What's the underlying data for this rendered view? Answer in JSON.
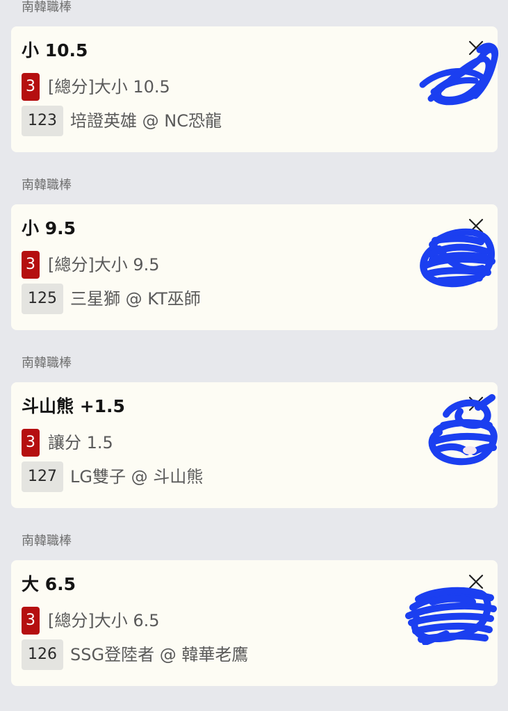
{
  "accent_color": "#b50f10",
  "scribble_color": "#1b3ff0",
  "close_icon": "close-icon",
  "bets": [
    {
      "league": "南韓職棒",
      "title": "小 10.5",
      "count": "3",
      "bet_type": "[總分]大小 10.5",
      "match_id": "123",
      "match": "培證英雄 @ NC恐龍"
    },
    {
      "league": "南韓職棒",
      "title": "小 9.5",
      "count": "3",
      "bet_type": "[總分]大小 9.5",
      "match_id": "125",
      "match": "三星獅 @ KT巫師"
    },
    {
      "league": "南韓職棒",
      "title": "斗山熊 +1.5",
      "count": "3",
      "bet_type": "讓分 1.5",
      "match_id": "127",
      "match": "LG雙子 @ 斗山熊"
    },
    {
      "league": "南韓職棒",
      "title": "大 6.5",
      "count": "3",
      "bet_type": "[總分]大小 6.5",
      "match_id": "126",
      "match": "SSG登陸者 @ 韓華老鷹"
    }
  ]
}
